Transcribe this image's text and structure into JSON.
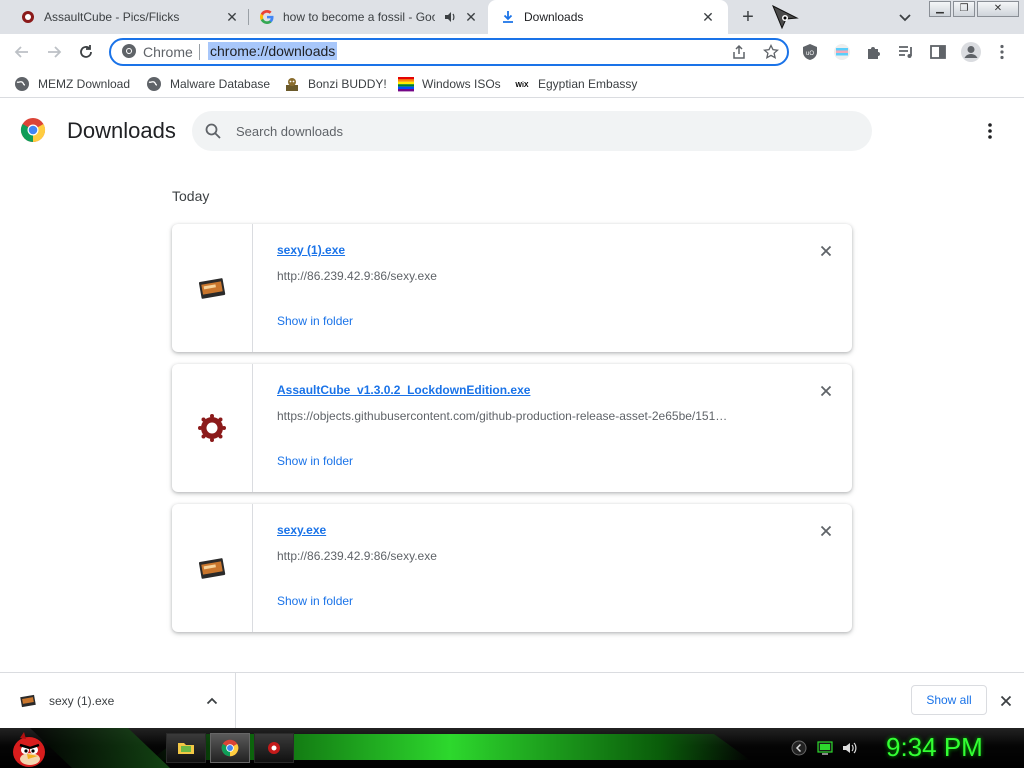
{
  "browser": {
    "tabs": [
      {
        "title": "AssaultCube - Pics/Flicks",
        "favicon": "assaultcube-icon",
        "active": false
      },
      {
        "title": "how to become a fossil - Goo",
        "favicon": "google-icon",
        "active": false,
        "audio": true
      },
      {
        "title": "Downloads",
        "favicon": "download-icon",
        "active": true
      }
    ],
    "omnibox": {
      "chip": "Chrome",
      "url": "chrome://downloads"
    },
    "bookmarks": [
      {
        "label": "MEMZ Download",
        "icon": "globe-icon"
      },
      {
        "label": "Malware Database",
        "icon": "globe-icon"
      },
      {
        "label": "Bonzi BUDDY!",
        "icon": "bonzi-icon"
      },
      {
        "label": "Windows ISOs",
        "icon": "windows-icon"
      },
      {
        "label": "Egyptian Embassy",
        "icon": "wix-icon"
      }
    ]
  },
  "downloads_page": {
    "title": "Downloads",
    "search_placeholder": "Search downloads",
    "section_date": "Today",
    "items": [
      {
        "name": "sexy (1).exe",
        "url": "http://86.239.42.9:86/sexy.exe",
        "action": "Show in folder",
        "icon": "exe-file-icon"
      },
      {
        "name": "AssaultCube_v1.3.0.2_LockdownEdition.exe",
        "url": "https://objects.githubusercontent.com/github-production-release-asset-2e65be/151…",
        "action": "Show in folder",
        "icon": "assaultcube-icon"
      },
      {
        "name": "sexy.exe",
        "url": "http://86.239.42.9:86/sexy.exe",
        "action": "Show in folder",
        "icon": "exe-file-icon"
      }
    ]
  },
  "download_shelf": {
    "item_name": "sexy (1).exe",
    "show_all": "Show all"
  },
  "taskbar": {
    "clock": "9:34 PM"
  },
  "colors": {
    "accent": "#1a73e8",
    "tab_strip": "#dee1e6",
    "clock_green": "#33ff33"
  }
}
